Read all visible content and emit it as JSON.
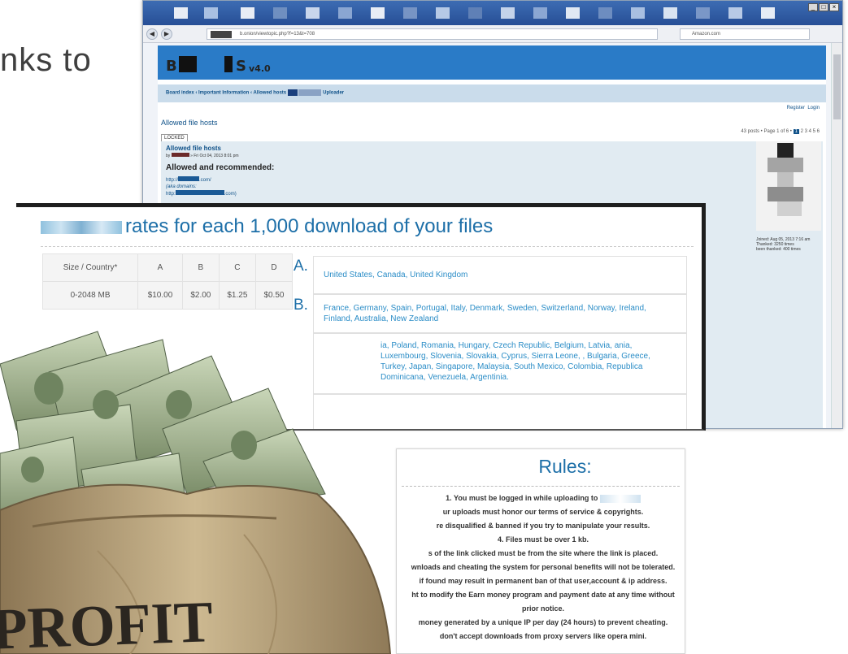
{
  "slide": {
    "text": "nks to"
  },
  "browser": {
    "url": "b.onion/viewtopic.php?f=13&t=708",
    "search": "Amazon.com"
  },
  "forum": {
    "logo_left": "B",
    "logo_right": "S",
    "logo_version": "v4.0",
    "breadcrumb_start": "Board index ‹ Important Information ‹ Allowed hosts",
    "breadcrumb_end": "Uploader",
    "register": "Register",
    "login": "Login",
    "topic_title": "Allowed file hosts",
    "locked_label": "LOCKED",
    "pagination": "43 posts • Page 1 of 6 •",
    "page_links": [
      "1",
      "2",
      "3",
      "4",
      "5",
      "6"
    ],
    "post_title": "Allowed file hosts",
    "post_by": "by",
    "post_date": "» Fri Oct 04, 2013 8:01 pm",
    "post_heading": "Allowed and recommended:",
    "link1_a": "http://",
    "link1_b": ".com/",
    "link2": "(aka domains:",
    "link3": "http:",
    "link3_b": ".com)",
    "profile_joined": "Joined: Aug 05, 2013 7:16 am",
    "profile_thanked": "Thanked: 3250 times",
    "profile_been": "been thanked: 400 times"
  },
  "rates": {
    "title": "rates for each 1,000 download of your files",
    "table": {
      "headers": [
        "Size / Country*",
        "A",
        "B",
        "C",
        "D"
      ],
      "row": [
        "0-2048 MB",
        "$10.00",
        "$2.00",
        "$1.25",
        "$0.50"
      ]
    },
    "groups": [
      {
        "letter": "A.",
        "countries": "United States, Canada, United Kingdom"
      },
      {
        "letter": "B.",
        "countries": "France, Germany, Spain, Portugal, Italy, Denmark, Sweden, Switzerland, Norway, Ireland, Finland, Australia, New Zealand"
      },
      {
        "letter": "",
        "countries": "ia, Poland, Romania, Hungary, Czech Republic, Belgium, Latvia, ania, Luxembourg, Slovenia, Slovakia, Cyprus, Sierra Leone, , Bulgaria, Greece, Turkey, Japan, Singapore, Malaysia, South Mexico, Colombia, Republica Dominicana, Venezuela, Argentinia."
      }
    ]
  },
  "rules": {
    "title": "Rules:",
    "items": [
      "1. You must be logged in while uploading to",
      "ur uploads must honor our terms of service & copyrights.",
      "re disqualified & banned if you try to manipulate your results.",
      "4. Files must be over 1 kb.",
      "s of the link clicked must be from the site where the link is placed.",
      "wnloads and cheating the system for personal benefits will not be tolerated.",
      "if found may result in permanent ban of that user,account & ip address.",
      "ht to modify the Earn money program and payment date at any time without",
      "prior notice.",
      "money generated by a unique IP per day (24 hours) to prevent cheating.",
      "don't accept downloads from proxy servers like opera mini."
    ]
  },
  "bag": {
    "label": "PROFIT"
  },
  "colors": {
    "forum_blue": "#2a7bc7",
    "rates_blue": "#1d6fa8",
    "bag": "#b9a27a"
  }
}
